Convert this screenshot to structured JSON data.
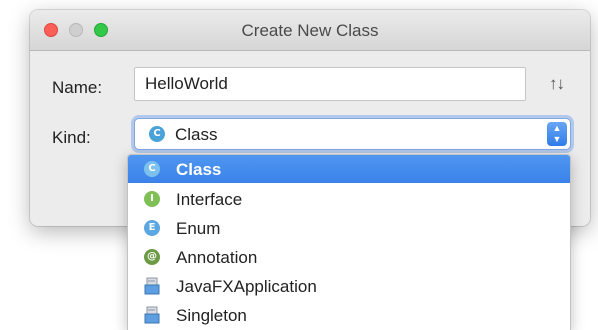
{
  "window": {
    "title": "Create New Class"
  },
  "form": {
    "name_label": "Name:",
    "name_value": "HelloWorld",
    "kind_label": "Kind:",
    "kind_value": "Class",
    "kind_value_badge": "C",
    "sort_icon": "↑↓"
  },
  "dropdown": {
    "options": [
      {
        "label": "Class",
        "badge": "C",
        "icon": "class-icon",
        "selected": true
      },
      {
        "label": "Interface",
        "badge": "I",
        "icon": "interface-icon"
      },
      {
        "label": "Enum",
        "badge": "E",
        "icon": "enum-icon"
      },
      {
        "label": "Annotation",
        "badge": "@",
        "icon": "annotation-icon"
      },
      {
        "label": "JavaFXApplication",
        "icon": "file-template-icon"
      },
      {
        "label": "Singleton",
        "icon": "file-template-icon"
      }
    ]
  },
  "colors": {
    "selection": "#3a82ea",
    "close": "#fc5f57",
    "maximize": "#34c84a"
  }
}
